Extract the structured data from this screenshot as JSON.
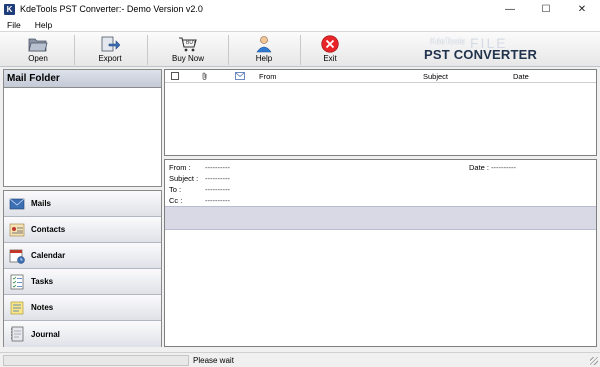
{
  "window": {
    "app_icon_letter": "K",
    "title": "KdeTools PST Converter:- Demo Version v2.0",
    "minimize_glyph": "—",
    "maximize_glyph": "☐",
    "close_glyph": "✕"
  },
  "menu": [
    "File",
    "Help"
  ],
  "toolbar": {
    "buttons": [
      {
        "label": "Open",
        "icon": "folder-open-icon"
      },
      {
        "label": "Export",
        "icon": "export-icon"
      },
      {
        "label": "Buy Now",
        "icon": "cart-icon"
      },
      {
        "label": "Help",
        "icon": "help-person-icon"
      },
      {
        "label": "Exit",
        "icon": "exit-icon"
      }
    ]
  },
  "brand": {
    "small": "KdeTools",
    "big": "PST CONVERTER",
    "watermark": "FILE"
  },
  "mail_folder": {
    "title": "Mail Folder"
  },
  "nav": [
    {
      "label": "Mails",
      "icon": "mail-icon"
    },
    {
      "label": "Contacts",
      "icon": "contacts-icon"
    },
    {
      "label": "Calendar",
      "icon": "calendar-icon"
    },
    {
      "label": "Tasks",
      "icon": "tasks-icon"
    },
    {
      "label": "Notes",
      "icon": "notes-icon"
    },
    {
      "label": "Journal",
      "icon": "journal-icon"
    }
  ],
  "message_list": {
    "columns": {
      "from": "From",
      "subject": "Subject",
      "date": "Date"
    }
  },
  "preview": {
    "from_label": "From :",
    "subject_label": "Subject :",
    "to_label": "To :",
    "cc_label": "Cc :",
    "date_label": "Date :",
    "placeholder": "----------"
  },
  "status": {
    "text": "Please wait"
  },
  "colors": {
    "accent": "#1f3d7a",
    "exit_red": "#e8262a"
  }
}
